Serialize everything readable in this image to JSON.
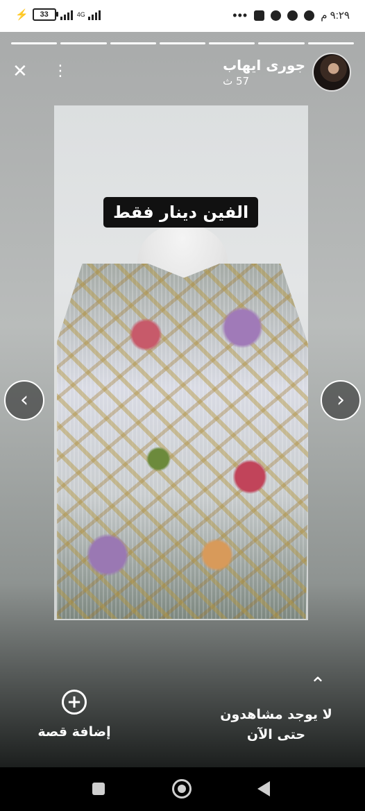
{
  "status_bar": {
    "battery": "33",
    "network": "4G",
    "time": "٩:٢٩ م",
    "overflow": "•••"
  },
  "story": {
    "progress_segments": 7,
    "author_name": "جورى ايهاب",
    "post_time": "57 ث",
    "close_glyph": "✕",
    "more_glyph": "⋮",
    "price_text": "الفين دينار فقط",
    "prev_glyph": "‹",
    "next_glyph": "›",
    "add_story_label": "إضافة قصة",
    "add_glyph": "+",
    "up_glyph": "⌃",
    "viewers_line1": "لا يوجد مشاهدون",
    "viewers_line2": "حتى الآن"
  }
}
